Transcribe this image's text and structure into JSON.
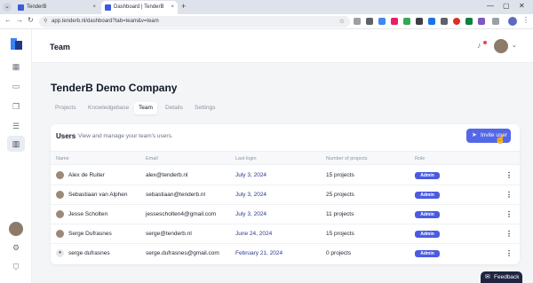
{
  "browser": {
    "tabs": [
      {
        "label": "TenderB",
        "active": false
      },
      {
        "label": "Dashboard | TenderB",
        "active": true
      }
    ],
    "new_tab_glyph": "+",
    "url": "app.tenderb.nl/dashboard?tab=team&v=team",
    "tab_close_glyph": "×",
    "window_controls": [
      "—",
      "▢",
      "✕"
    ]
  },
  "header": {
    "title": "Team"
  },
  "company": {
    "name": "TenderB Demo Company",
    "tabs": [
      {
        "label": "Projects",
        "active": false
      },
      {
        "label": "Knowledgebase",
        "active": false
      },
      {
        "label": "Team",
        "active": true
      },
      {
        "label": "Details",
        "active": false
      },
      {
        "label": "Settings",
        "active": false
      }
    ]
  },
  "users": {
    "title": "Users",
    "description": "View and manage your team's users.",
    "invite_label": "Invite user",
    "columns": [
      "Name",
      "Email",
      "Last login",
      "Number of projects",
      "Role"
    ],
    "rows": [
      {
        "name": "Alex de Ruiter",
        "email": "alex@tenderb.nl",
        "last_login": "July 3, 2024",
        "projects": "15 projects",
        "role": "Admin",
        "avatar": "photo"
      },
      {
        "name": "Sebastiaan van Alphen",
        "email": "sebastiaan@tenderb.nl",
        "last_login": "July 3, 2024",
        "projects": "25 projects",
        "role": "Admin",
        "avatar": "photo"
      },
      {
        "name": "Jesse Scholten",
        "email": "jessescholten4@gmail.com",
        "last_login": "July 3, 2024",
        "projects": "11 projects",
        "role": "Admin",
        "avatar": "photo"
      },
      {
        "name": "Serge Dufrasnes",
        "email": "serge@tenderb.nl",
        "last_login": "June 24, 2024",
        "projects": "15 projects",
        "role": "Admin",
        "avatar": "photo"
      },
      {
        "name": "serge dufrasnes",
        "email": "serge.dufrasnes@gmail.com",
        "last_login": "February 21, 2024",
        "projects": "0 projects",
        "role": "Admin",
        "avatar": "generic"
      }
    ]
  },
  "feedback": {
    "label": "Feedback"
  },
  "colors": {
    "accent": "#5468e7",
    "role_badge": "#4a5be0",
    "date_text": "#2a3a8c",
    "feedback_bg": "#1f2440"
  }
}
